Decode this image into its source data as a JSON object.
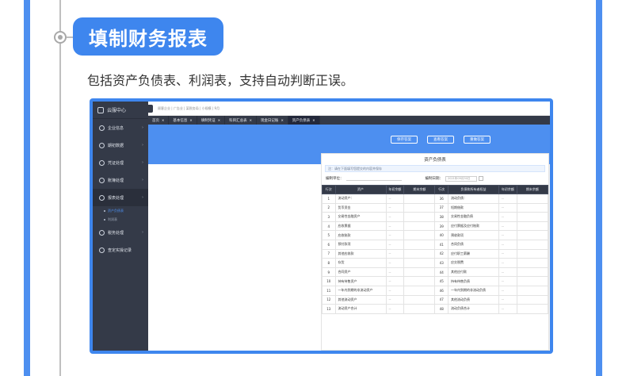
{
  "heading": "填制财务报表",
  "subtitle": "包括资产负债表、利润表，支持自动判断正误。",
  "app": {
    "brand": "云服中心",
    "breadcrumb": "顾客企业 | 广告业 | 某税务局 | 小规模 | 9月",
    "sidebar": [
      {
        "label": "企业信息",
        "active": false
      },
      {
        "label": "期初数据",
        "active": false
      },
      {
        "label": "凭证处理",
        "active": false
      },
      {
        "label": "账簿处理",
        "active": false
      },
      {
        "label": "报表处理",
        "active": true
      },
      {
        "label": "税务处理",
        "active": false
      },
      {
        "label": "查定实操记录",
        "active": false
      }
    ],
    "sidebar_sub": [
      "资产负债表",
      "利润表"
    ],
    "tabs": [
      {
        "label": "首页",
        "active": false
      },
      {
        "label": "基本信息",
        "active": false
      },
      {
        "label": "填制凭证",
        "active": false
      },
      {
        "label": "科目汇总表",
        "active": false
      },
      {
        "label": "现金日记账",
        "active": false
      },
      {
        "label": "资产负债表",
        "active": true
      }
    ],
    "buttons": [
      "保存答案",
      "查看答案",
      "重做答案"
    ],
    "sheet": {
      "title": "资产负债表",
      "note": "注：请在下面填写您提交的内容并保存",
      "unit_label": "编制单位：",
      "date_label": "编制日期：",
      "date_value": "2021年09月30日",
      "columns": [
        "行次",
        "资产",
        "年初余额",
        "期末余额",
        "行次",
        "负债和所有者权益",
        "年初余额",
        "期末余额"
      ],
      "rows": [
        [
          "1",
          "流动资产：",
          "--",
          "",
          "36",
          "流动负债：",
          "--",
          ""
        ],
        [
          "2",
          "货币资金",
          "--",
          "",
          "37",
          "短期借款",
          "--",
          ""
        ],
        [
          "3",
          "交易性金融资产",
          "--",
          "",
          "38",
          "交易性金融负债",
          "--",
          ""
        ],
        [
          "4",
          "应收票据",
          "--",
          "",
          "39",
          "应付票据及应付账款",
          "--",
          ""
        ],
        [
          "5",
          "应收账款",
          "--",
          "",
          "40",
          "预收款项",
          "--",
          ""
        ],
        [
          "6",
          "预付款项",
          "--",
          "",
          "41",
          "合同负债",
          "--",
          ""
        ],
        [
          "7",
          "其他应收款",
          "--",
          "",
          "42",
          "应付职工薪酬",
          "--",
          ""
        ],
        [
          "8",
          "存货",
          "--",
          "",
          "43",
          "应交税费",
          "--",
          ""
        ],
        [
          "9",
          "合同资产",
          "--",
          "",
          "44",
          "其他应付款",
          "--",
          ""
        ],
        [
          "10",
          "持有待售资产",
          "--",
          "",
          "45",
          "持有待售负债",
          "--",
          ""
        ],
        [
          "11",
          "一年内到期的非流动资产",
          "--",
          "",
          "46",
          "一年内到期的非流动负债",
          "--",
          ""
        ],
        [
          "12",
          "其他流动资产",
          "--",
          "",
          "47",
          "其他流动负债",
          "--",
          ""
        ],
        [
          "13",
          "流动资产合计",
          "--",
          "",
          "48",
          "流动负债合计",
          "--",
          ""
        ]
      ]
    }
  }
}
